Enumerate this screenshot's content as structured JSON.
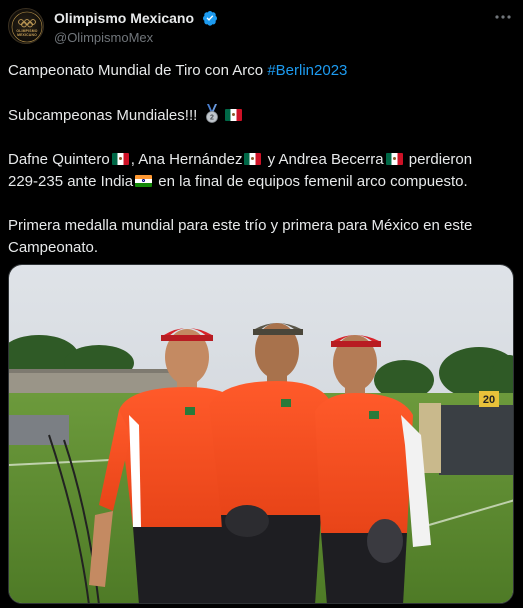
{
  "account": {
    "display_name": "Olimpismo Mexicano",
    "handle": "@OlimpismoMex",
    "verified": true,
    "avatar_text": "OLIMPISMO MEXICANO"
  },
  "tweet": {
    "line1_text": "Campeonato Mundial de Tiro con Arco ",
    "line1_hashtag": "#Berlin2023",
    "line2_text": "Subcampeonas Mundiales!!! ",
    "line3_name1": "Dafne Quintero",
    "line3_name2": ", Ana Hernández",
    "line3_name3": " y Andrea Becerra",
    "line3_end": " perdieron",
    "line4_start": "229-235 ante India",
    "line4_end": " en la final de equipos femenil arco compuesto.",
    "paragraph4": "Primera medalla mundial para este trío y primera para México en este Campeonato."
  },
  "photo": {
    "target_number": "20"
  },
  "colors": {
    "background": "#000000",
    "text": "#e7e9ea",
    "secondary_text": "#71767b",
    "link": "#1d9bf0",
    "verified": "#1d9bf0"
  },
  "icons": [
    "verified-badge-icon",
    "more-options-icon",
    "silver-medal-icon",
    "mexico-flag-icon",
    "india-flag-icon"
  ]
}
